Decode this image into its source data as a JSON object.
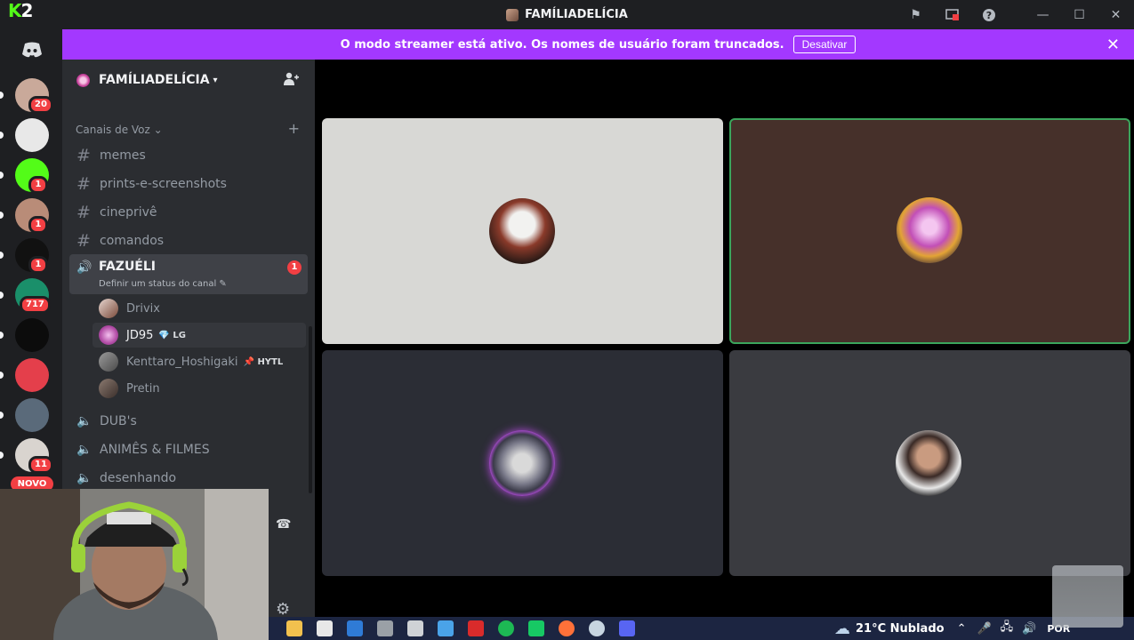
{
  "app": {
    "logo_text": "K2",
    "window_title": "FAMÍLIADELÍCIA"
  },
  "banner": {
    "message": "O modo streamer está ativo. Os nomes de usuário foram truncados.",
    "button_label": "Desativar"
  },
  "guild_rail": {
    "items": [
      {
        "name": "server-1",
        "badge": "20",
        "color": "#c9a99a"
      },
      {
        "name": "server-2",
        "badge": "",
        "color": "#e8e8e8"
      },
      {
        "name": "server-3",
        "badge": "1",
        "color": "#53fc18"
      },
      {
        "name": "server-4",
        "badge": "1",
        "color": "#b98c78"
      },
      {
        "name": "server-5",
        "badge": "1",
        "color": "#111111"
      },
      {
        "name": "server-6",
        "badge": "717",
        "color": "#1a8f6a"
      },
      {
        "name": "server-7",
        "badge": "",
        "color": "#0c0c0c"
      },
      {
        "name": "server-8",
        "badge": "",
        "color": "#e43f4b"
      },
      {
        "name": "server-9",
        "badge": "",
        "color": "#5a6a7a"
      },
      {
        "name": "server-10",
        "badge": "11",
        "color": "#d9d4cf"
      }
    ],
    "new_label": "NOVO"
  },
  "sidebar": {
    "server_name": "FAMÍLIADELÍCIA",
    "category": "Canais de Voz",
    "text_channels": [
      "memes",
      "prints-e-screenshots",
      "cineprivê",
      "comandos"
    ],
    "active_channel": {
      "name": "FAZUÉLI",
      "badge": "1",
      "status": "Definir um status do canal"
    },
    "members": [
      {
        "name": "Drivix",
        "tag": ""
      },
      {
        "name": "JD95",
        "tag": "LG"
      },
      {
        "name": "Kenttaro_Hoshigaki",
        "tag": "HYTL"
      },
      {
        "name": "Pretin",
        "tag": ""
      }
    ],
    "voice_channels": [
      "DUB's",
      "ANIMÊS & FILMES",
      "desenhando"
    ]
  },
  "taskbar": {
    "weather": "21°C  Nublado",
    "language": "POR"
  }
}
